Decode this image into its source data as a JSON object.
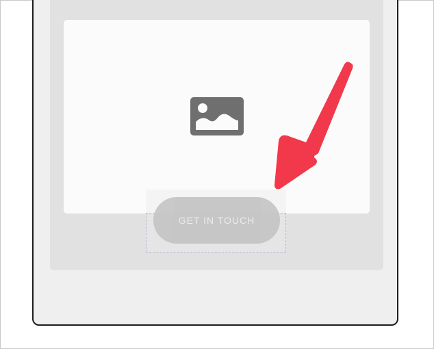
{
  "canvas": {
    "background_color": "#ffffff",
    "frame_color": "#1c1c1c"
  },
  "content_panel": {
    "background_color": "#e1e1e1"
  },
  "image_placeholder": {
    "icon": "image-icon",
    "icon_color": "#6f6f6f",
    "background_color": "#fbfbfb"
  },
  "cta_button": {
    "label": "GET IN TOUCH",
    "background_color": "#c4c4c4"
  },
  "annotation_arrow": {
    "icon": "arrow-icon",
    "color": "#f2384b"
  }
}
